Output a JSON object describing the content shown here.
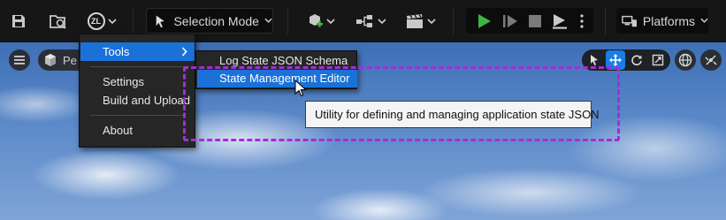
{
  "toolbar": {
    "save_icon": "save-icon",
    "content_browser_icon": "content-browser-icon",
    "zl_badge": "ZL",
    "selection_mode_label": "Selection Mode",
    "platforms_label": "Platforms"
  },
  "viewport": {
    "perspective_label": "Pe"
  },
  "menu": {
    "items": [
      {
        "label": "Tools"
      },
      {
        "label": "Settings"
      },
      {
        "label": "Build and Upload"
      },
      {
        "label": "About"
      }
    ],
    "submenu": [
      {
        "label": "Log State JSON Schema"
      },
      {
        "label": "State Management Editor"
      }
    ]
  },
  "tooltip": {
    "text": "Utility for defining and managing application state JSON"
  },
  "colors": {
    "toolbar_bg": "#161616",
    "menu_bg": "#262626",
    "menu_highlight": "#1a72d9",
    "play_green": "#3fb53f",
    "annotation_purple": "#a52cd9",
    "tooltip_bg": "#f4f4f4"
  }
}
